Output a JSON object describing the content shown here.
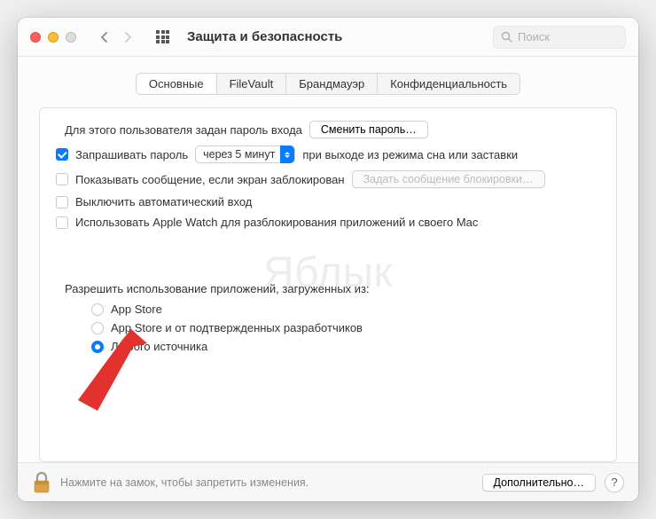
{
  "header": {
    "title": "Защита и безопасность",
    "search_placeholder": "Поиск"
  },
  "tabs": [
    "Основные",
    "FileVault",
    "Брандмауэр",
    "Конфиденциальность"
  ],
  "panel": {
    "login_password_label": "Для этого пользователя задан пароль входа",
    "change_password_btn": "Сменить пароль…",
    "require_password_label": "Запрашивать пароль",
    "require_password_delay": "через 5 минут",
    "require_password_suffix": "при выходе из режима сна или заставки",
    "show_message_label": "Показывать сообщение, если экран заблокирован",
    "set_lock_message_btn": "Задать сообщение блокировки…",
    "disable_autologin_label": "Выключить автоматический вход",
    "apple_watch_label": "Использовать Apple Watch для разблокирования приложений и своего Mac",
    "allow_apps_label": "Разрешить использование приложений, загруженных из:",
    "radios": [
      "App Store",
      "App Store и от подтвержденных разработчиков",
      "Любого источника"
    ]
  },
  "footer": {
    "lock_text": "Нажмите на замок, чтобы запретить изменения.",
    "advanced_btn": "Дополнительно…",
    "help": "?"
  },
  "watermark": "Яблык"
}
